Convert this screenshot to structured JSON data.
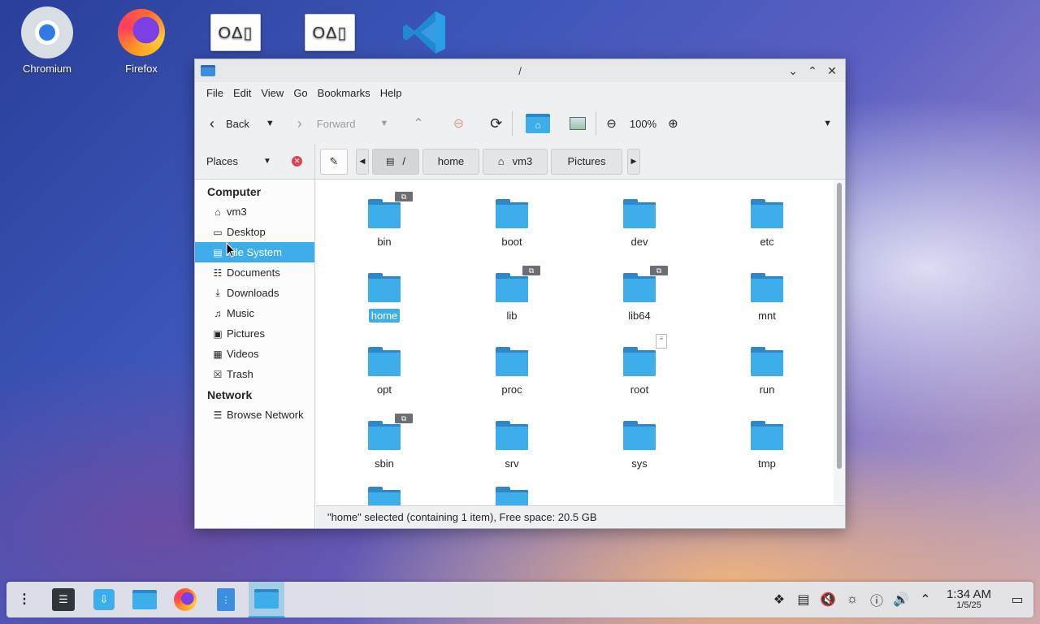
{
  "desktop": {
    "icons": [
      {
        "label": "Chromium",
        "icon": "chromium-icon"
      },
      {
        "label": "Firefox",
        "icon": "firefox-icon"
      },
      {
        "label": "",
        "icon": "generic-app-icon",
        "glyph": "OΔ▯"
      },
      {
        "label": "",
        "icon": "generic-app-icon",
        "glyph": "OΔ▯"
      },
      {
        "label": "",
        "icon": "vscode-icon"
      }
    ]
  },
  "window": {
    "title": "/",
    "menu": [
      "File",
      "Edit",
      "View",
      "Go",
      "Bookmarks",
      "Help"
    ],
    "toolbar": {
      "back_label": "Back",
      "forward_label": "Forward",
      "zoom_label": "100%"
    },
    "places_label": "Places",
    "breadcrumbs": [
      "/",
      "home",
      "vm3",
      "Pictures"
    ],
    "sidebar": {
      "computer_heading": "Computer",
      "computer_items": [
        {
          "label": "vm3",
          "icon": "home-icon",
          "glyph": "⌂"
        },
        {
          "label": "Desktop",
          "icon": "desktop-icon",
          "glyph": "▭"
        },
        {
          "label": "File System",
          "icon": "drive-icon",
          "glyph": "▤"
        },
        {
          "label": "Documents",
          "icon": "document-icon",
          "glyph": "☷"
        },
        {
          "label": "Downloads",
          "icon": "download-icon",
          "glyph": "⤓"
        },
        {
          "label": "Music",
          "icon": "music-icon",
          "glyph": "♫"
        },
        {
          "label": "Pictures",
          "icon": "pictures-icon",
          "glyph": "▣"
        },
        {
          "label": "Videos",
          "icon": "video-icon",
          "glyph": "▦"
        },
        {
          "label": "Trash",
          "icon": "trash-icon",
          "glyph": "☒"
        }
      ],
      "network_heading": "Network",
      "network_items": [
        {
          "label": "Browse Network",
          "icon": "network-icon",
          "glyph": "☰"
        }
      ]
    },
    "files": [
      {
        "name": "bin",
        "badge": "link"
      },
      {
        "name": "boot",
        "badge": ""
      },
      {
        "name": "dev",
        "badge": ""
      },
      {
        "name": "etc",
        "badge": ""
      },
      {
        "name": "home",
        "badge": "",
        "selected": true
      },
      {
        "name": "lib",
        "badge": "link"
      },
      {
        "name": "lib64",
        "badge": "link"
      },
      {
        "name": "mnt",
        "badge": ""
      },
      {
        "name": "opt",
        "badge": ""
      },
      {
        "name": "proc",
        "badge": ""
      },
      {
        "name": "root",
        "badge": "doc"
      },
      {
        "name": "run",
        "badge": ""
      },
      {
        "name": "sbin",
        "badge": "link"
      },
      {
        "name": "srv",
        "badge": ""
      },
      {
        "name": "sys",
        "badge": ""
      },
      {
        "name": "tmp",
        "badge": ""
      },
      {
        "name": "",
        "badge": ""
      },
      {
        "name": "",
        "badge": ""
      }
    ],
    "status": "\"home\" selected (containing 1 item), Free space: 20.5 GB"
  },
  "taskbar": {
    "clock_time": "1:34 AM",
    "clock_date": "1/5/25"
  },
  "colors": {
    "accent": "#3daee9",
    "folder": "#3daee9"
  }
}
